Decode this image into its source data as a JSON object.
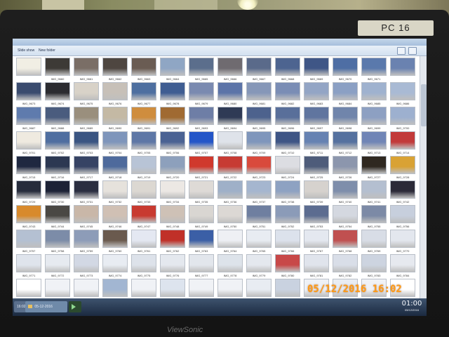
{
  "monitor": {
    "label": "PC 16",
    "brand": "ViewSonic"
  },
  "window": {
    "toolbar_items": [
      "Slide show",
      "New folder"
    ]
  },
  "taskbar": {
    "items": [
      "16:02",
      "05-12-2016",
      ""
    ],
    "clock_time": "01:00",
    "clock_date": "05/12/2016"
  },
  "camera_stamp": "05/12/2016  16:02",
  "photo_grid": {
    "columns": 14,
    "rows": [
      {
        "captions": [
          "",
          "IMG_9660",
          "IMG_9661",
          "IMG_9662",
          "IMG_9663",
          "IMG_9664",
          "IMG_9665",
          "IMG_9666",
          "IMG_9667",
          "IMG_9668",
          "IMG_9669",
          "IMG_9670",
          "IMG_9671",
          ""
        ]
      },
      {
        "captions": [
          "IMG_9673",
          "IMG_9674",
          "IMG_9675",
          "IMG_9676",
          "IMG_9677",
          "IMG_9678",
          "IMG_9679",
          "IMG_9680",
          "IMG_9681",
          "IMG_9682",
          "IMG_9683",
          "IMG_9684",
          "IMG_9685",
          "IMG_9686"
        ]
      },
      {
        "captions": [
          "IMG_9687",
          "IMG_9688",
          "IMG_9689",
          "IMG_9690",
          "IMG_9691",
          "IMG_9692",
          "IMG_9693",
          "IMG_9694",
          "IMG_9695",
          "IMG_9696",
          "IMG_9697",
          "IMG_9698",
          "IMG_9699",
          "IMG_9700"
        ]
      },
      {
        "captions": [
          "IMG_9701",
          "IMG_9702",
          "IMG_9703",
          "IMG_9704",
          "IMG_9705",
          "IMG_9706",
          "IMG_9707",
          "IMG_9708",
          "IMG_9709",
          "IMG_9710",
          "IMG_9711",
          "IMG_9712",
          "IMG_9713",
          "IMG_9714"
        ]
      },
      {
        "captions": [
          "IMG_9715",
          "IMG_9716",
          "IMG_9717",
          "IMG_9718",
          "IMG_9719",
          "IMG_9720",
          "IMG_9721",
          "IMG_9722",
          "IMG_9723",
          "IMG_9724",
          "IMG_9725",
          "IMG_9726",
          "IMG_9727",
          "IMG_9728"
        ]
      },
      {
        "captions": [
          "IMG_9729",
          "IMG_9730",
          "IMG_9731",
          "IMG_9732",
          "IMG_9733",
          "IMG_9734",
          "IMG_9735",
          "IMG_9736",
          "IMG_9737",
          "IMG_9738",
          "IMG_9739",
          "IMG_9740",
          "IMG_9741",
          "IMG_9742"
        ]
      },
      {
        "captions": [
          "IMG_9743",
          "IMG_9744",
          "IMG_9745",
          "IMG_9746",
          "IMG_9747",
          "IMG_9748",
          "IMG_9749",
          "IMG_9750",
          "IMG_9751",
          "IMG_9752",
          "IMG_9753",
          "IMG_9754",
          "IMG_9755",
          "IMG_9756"
        ]
      },
      {
        "captions": [
          "IMG_9757",
          "IMG_9758",
          "IMG_9759",
          "IMG_9760",
          "IMG_9761",
          "IMG_9762",
          "IMG_9763",
          "IMG_9764",
          "IMG_9765",
          "IMG_9766",
          "IMG_9767",
          "IMG_9768",
          "IMG_9769",
          "IMG_9770"
        ]
      },
      {
        "captions": [
          "IMG_9771",
          "IMG_9772",
          "IMG_9773",
          "IMG_9774",
          "IMG_9775",
          "IMG_9776",
          "IMG_9777",
          "IMG_9778",
          "IMG_9779",
          "IMG_9780",
          "IMG_9781",
          "IMG_9782",
          "IMG_9783",
          "IMG_9784"
        ]
      },
      {
        "captions": [
          "",
          "",
          "",
          "",
          "",
          "",
          "",
          "",
          "",
          "",
          "",
          "",
          "",
          ""
        ]
      }
    ],
    "thumb_colors": [
      [
        "#f1eee4",
        "#3d3a36",
        "#7a6e66",
        "#4e4640",
        "#6a5c53",
        "#8fa6c4",
        "#5b6e8c",
        "#6f6b70",
        "#5a6a8a",
        "#4d6490",
        "#3f5686",
        "#4e6ea4",
        "#5a79ac",
        "#6a82b0"
      ],
      [
        "#3a4b6e",
        "#2b2b30",
        "#d8d2c8",
        "#c7c0b8",
        "#4e6fa0",
        "#3f5d92",
        "#7a8ab0",
        "#5c74a8",
        "#8697b8",
        "#7a8db5",
        "#93a5c5",
        "#8ba0c4",
        "#9fb2cf",
        "#a9bad4"
      ],
      [
        "#5f7bad",
        "#4a5c7e",
        "#9a8f7d",
        "#c4b9a4",
        "#cf8d3e",
        "#a06a32",
        "#6e7ea6",
        "#2f3a55",
        "#4d628d",
        "#596f9a",
        "#60759f",
        "#7085ab",
        "#8da0c2",
        "#9db0cf"
      ],
      [
        "#efeae0",
        "#4f6ea0",
        "#3a5582",
        "#7e95bb",
        "#5e77a6",
        "#4a6293",
        "#2456c8",
        "#dfe3ea",
        "#7f96bc",
        "#3e5585",
        "#6682b2",
        "#55719f",
        "#7085b6",
        "#c23a3a"
      ],
      [
        "#1f2840",
        "#2c3852",
        "#364364",
        "#4e6a9c",
        "#b8c4d6",
        "#8da0bc",
        "#d0392d",
        "#c73b33",
        "#d94a3c",
        "#dcdde2",
        "#4e5c7a",
        "#8c96ad",
        "#2f2820",
        "#d9a234"
      ],
      [
        "#262c3c",
        "#1c2236",
        "#2a2e40",
        "#e6e2dc",
        "#dcd8d2",
        "#ece8e4",
        "#dedad6",
        "#9fb0c8",
        "#a5b6cf",
        "#8ea2c2",
        "#d6d2ce",
        "#7e8eab",
        "#b4bfd0",
        "#2b2a38"
      ],
      [
        "#d88a2c",
        "#4a4844",
        "#c9b7a8",
        "#d0c0b4",
        "#c83a30",
        "#cec1b6",
        "#d9d6d2",
        "#dcd8d4",
        "#6f7fa0",
        "#8b9bb8",
        "#5c6c90",
        "#d4d8e0",
        "#7c8aa6",
        "#c7cfdd"
      ],
      [
        "#b4c0d2",
        "#7c8ca8",
        "#8d9cb8",
        "#6a5a4e",
        "#e4e8f2",
        "#c03028",
        "#3b5fa6",
        "#eef0f4",
        "#e8ecf2",
        "#dce2ec",
        "#e4e8f0",
        "#c05050",
        "#d8dde6",
        "#e3e7ee"
      ],
      [
        "#dfe4ec",
        "#e6eaf0",
        "#d2d8e4",
        "#e8ecf2",
        "#dde2ea",
        "#e4e8ee",
        "#e2e6ec",
        "#dde3ea",
        "#e4e8ee",
        "#c84848",
        "#e0e4ec",
        "#d9dee8",
        "#cdd4e0",
        "#e6e9ef"
      ],
      [
        "#ffffff",
        "#f0f2f6",
        "#f0f2f6",
        "#a2b6d2",
        "#f0f2f6",
        "#dde4ee",
        "#f0f2f6",
        "#f0f2f6",
        "#e8ecf2",
        "#c9d2e0",
        "#eef1f6",
        "#e9edf3",
        "#f0f2f6",
        "#ffffff"
      ]
    ]
  }
}
